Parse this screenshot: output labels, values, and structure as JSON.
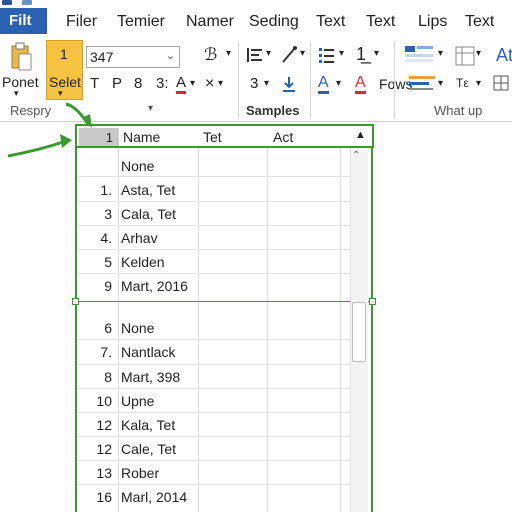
{
  "menubar": {
    "file": "Filt",
    "items": [
      "Filer",
      "Temier",
      "Namer",
      "Seding",
      "Text",
      "Text",
      "Lips",
      "Text"
    ]
  },
  "ribbon": {
    "paste_label": "Ponet",
    "select_label": "Selet",
    "select_top": "1",
    "font_name": "347",
    "font_row": [
      "T",
      "P",
      "8",
      "3:"
    ],
    "font_color_letter": "A",
    "style_num": "3",
    "fows_label": "Fows",
    "at_label": "At",
    "groups": [
      "Respry",
      "Samples",
      "What up"
    ],
    "accent_red": "#d32f2f",
    "accent_blue": "#2b61b3",
    "highlight": "#f6c244"
  },
  "grid": {
    "header": {
      "num": "1",
      "col1": "Name",
      "col2": "Tet",
      "col3": "Act"
    },
    "rows_top": [
      {
        "num": "",
        "name": "None"
      },
      {
        "num": "1.",
        "name": "Asta, Tet"
      },
      {
        "num": "3",
        "name": "Cala, Tet"
      },
      {
        "num": "4.",
        "name": "Arhav"
      },
      {
        "num": "5",
        "name": "Kelden"
      },
      {
        "num": "9",
        "name": "Mart, 2016"
      }
    ],
    "rows_bottom": [
      {
        "num": "6",
        "name": "None"
      },
      {
        "num": "7.",
        "name": "Nantlack"
      },
      {
        "num": "8",
        "name": "Mart, 398"
      },
      {
        "num": "10",
        "name": "Upne"
      },
      {
        "num": "12",
        "name": "Kala, Tet"
      },
      {
        "num": "12",
        "name": "Cale, Tet"
      },
      {
        "num": "13",
        "name": "Rober"
      },
      {
        "num": "16",
        "name": "Marl, 2014"
      }
    ],
    "selection_color": "#3a9a2e"
  }
}
